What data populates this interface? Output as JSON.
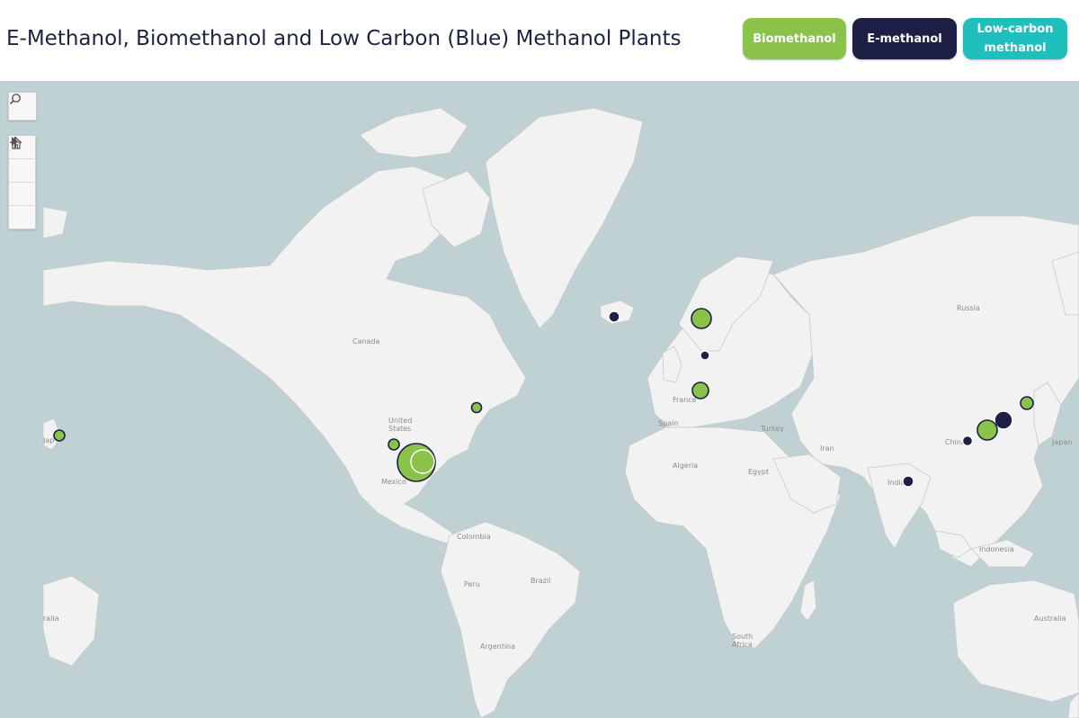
{
  "title": "E-Methanol, Biomethanol and Low Carbon (Blue) Methanol Plants",
  "legend": [
    {
      "label": "Biomethanol",
      "color": "#8bc34a"
    },
    {
      "label": "E-methanol",
      "color": "#1d1f45"
    },
    {
      "label": "Low-carbon\nmethanol",
      "color": "#1fbfbe"
    }
  ],
  "map_labels": {
    "canada": "Canada",
    "united_states": "United\nStates",
    "mexico": "Mexico",
    "colombia": "Colombia",
    "peru": "Peru",
    "brazil": "Brazil",
    "argentina": "Argentina",
    "russia": "Russia",
    "france": "France",
    "spain": "Spain",
    "turkey": "Turkey",
    "iran": "Iran",
    "algeria": "Algeria",
    "egypt": "Egypt",
    "south_africa": "South\nAfrica",
    "china": "China",
    "india": "India",
    "indonesia": "Indonesia",
    "australia": "Australia",
    "australia_west": "ralia",
    "japan_west": "Jap",
    "japan_east": "Japan"
  },
  "colors": {
    "ocean": "#bfd1d2",
    "land": "#f2f2f2",
    "border": "#c9c9c9",
    "biomethanol": "#8bc34a",
    "e_methanol": "#1d1f45",
    "low_carbon": "#1fbfbe"
  },
  "plants": [
    {
      "location": "Western Pacific (Japan edge)",
      "type": "biomethanol",
      "size": "small"
    },
    {
      "location": "Texas / Gulf Coast (large)",
      "type": "biomethanol",
      "size": "large"
    },
    {
      "location": "Texas / Gulf Coast",
      "type": "biomethanol",
      "size": "medium"
    },
    {
      "location": "Southwestern US",
      "type": "biomethanol",
      "size": "small"
    },
    {
      "location": "Northeastern US / Canada",
      "type": "biomethanol",
      "size": "small"
    },
    {
      "location": "Iceland",
      "type": "e_methanol",
      "size": "small"
    },
    {
      "location": "Norway",
      "type": "biomethanol",
      "size": "medium"
    },
    {
      "location": "Denmark",
      "type": "e_methanol",
      "size": "small"
    },
    {
      "location": "France / Belgium",
      "type": "biomethanol",
      "size": "medium"
    },
    {
      "location": "China (north)",
      "type": "e_methanol",
      "size": "medium"
    },
    {
      "location": "China (east)",
      "type": "biomethanol",
      "size": "medium"
    },
    {
      "location": "China (central)",
      "type": "e_methanol",
      "size": "small"
    },
    {
      "location": "Northeast China",
      "type": "biomethanol",
      "size": "small"
    },
    {
      "location": "India",
      "type": "e_methanol",
      "size": "small"
    }
  ],
  "controls": {
    "search": "search-icon",
    "zoom_in": "plus-icon",
    "zoom_out": "minus-icon",
    "home": "home-icon",
    "play": "play-icon"
  }
}
